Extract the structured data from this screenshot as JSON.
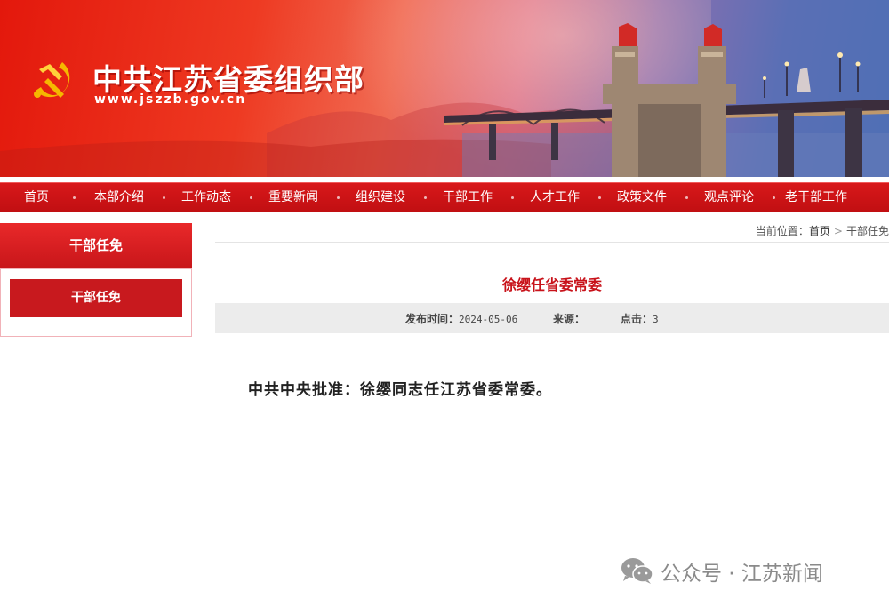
{
  "header": {
    "site_title": "中共江苏省委组织部",
    "site_url": "www.jszzb.gov.cn",
    "colors": {
      "banner_red": "#e3180c",
      "accent_red": "#c8121a"
    },
    "emblem_icon": "party-emblem-icon"
  },
  "nav": {
    "items": [
      {
        "label": "首页"
      },
      {
        "label": "本部介绍"
      },
      {
        "label": "工作动态"
      },
      {
        "label": "重要新闻"
      },
      {
        "label": "组织建设"
      },
      {
        "label": "干部工作"
      },
      {
        "label": "人才工作"
      },
      {
        "label": "政策文件"
      },
      {
        "label": "观点评论"
      },
      {
        "label": "老干部工作"
      }
    ]
  },
  "sidebar": {
    "header_label": "干部任免",
    "items": [
      {
        "label": "干部任免"
      }
    ]
  },
  "breadcrumb": {
    "prefix": "当前位置：",
    "home": "首页",
    "separator": ">",
    "current": "干部任免"
  },
  "article": {
    "title": "徐缨任省委常委",
    "publish_label": "发布时间：",
    "publish_date": "2024-05-06",
    "source_label": "来源：",
    "source_value": "",
    "clicks_label": "点击：",
    "clicks_value": "3",
    "body": "中共中央批准：徐缨同志任江苏省委常委。"
  },
  "watermark": {
    "text": "公众号 · 江苏新闻",
    "icon": "wechat-icon"
  }
}
